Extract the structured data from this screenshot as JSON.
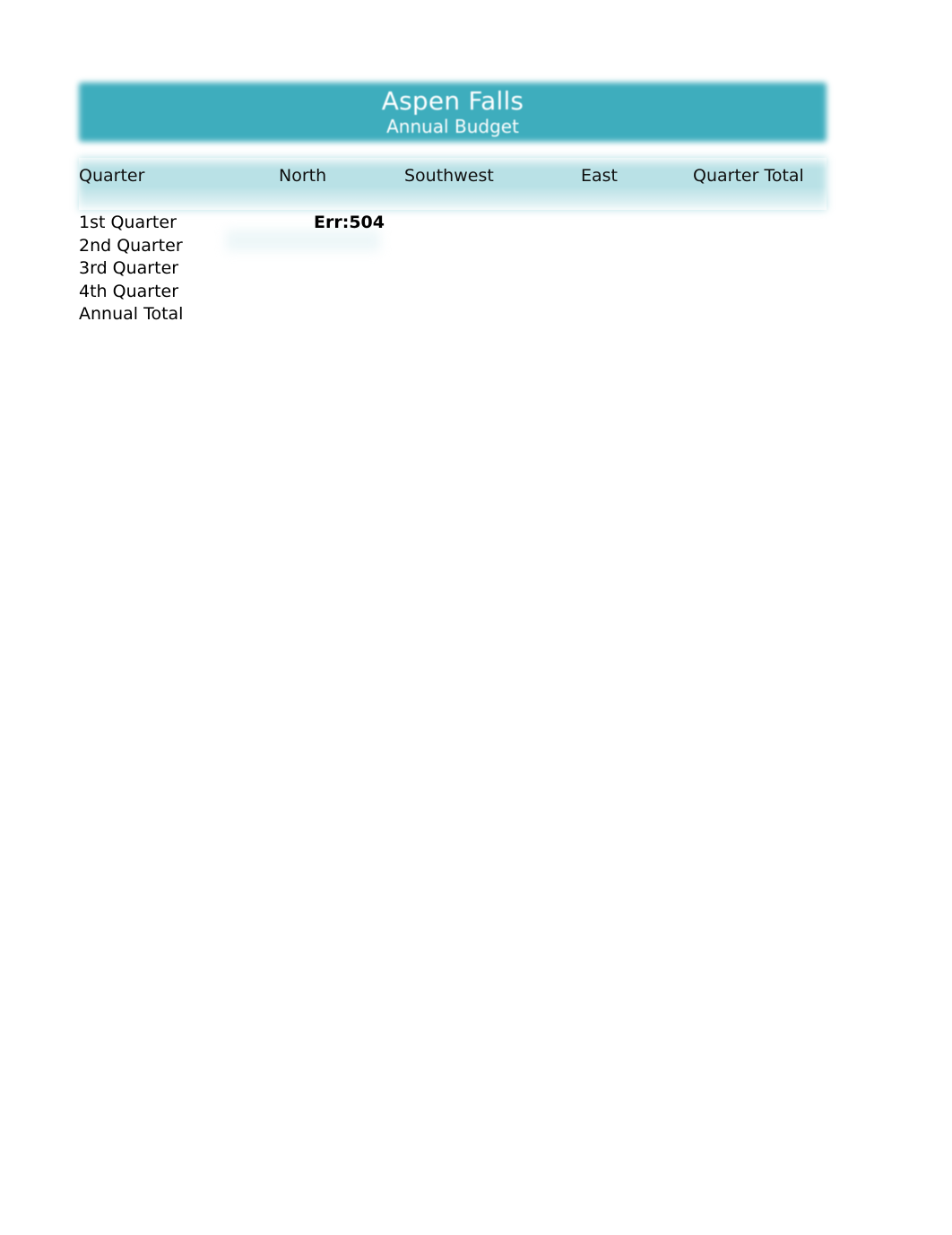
{
  "document": {
    "title": "Aspen Falls",
    "subtitle": "Annual Budget"
  },
  "colors": {
    "banner_teal": "#3EADBD",
    "header_band": "#B9E1E6",
    "page_background": "#FFFFFF",
    "text": "#000000",
    "banner_text": "#FFFFFF"
  },
  "table": {
    "columns": [
      {
        "key": "quarter",
        "label": "Quarter"
      },
      {
        "key": "north",
        "label": "North"
      },
      {
        "key": "southwest",
        "label": "Southwest"
      },
      {
        "key": "east",
        "label": "East"
      },
      {
        "key": "quarter_total",
        "label": "Quarter Total"
      }
    ],
    "rows": [
      {
        "quarter": "1st Quarter",
        "north": "Err:504",
        "southwest": "",
        "east": "",
        "quarter_total": ""
      },
      {
        "quarter": "2nd Quarter",
        "north": "",
        "southwest": "",
        "east": "",
        "quarter_total": ""
      },
      {
        "quarter": "3rd Quarter",
        "north": "",
        "southwest": "",
        "east": "",
        "quarter_total": ""
      },
      {
        "quarter": "4th Quarter",
        "north": "",
        "southwest": "",
        "east": "",
        "quarter_total": ""
      },
      {
        "quarter": "Annual Total",
        "north": "",
        "southwest": "",
        "east": "",
        "quarter_total": ""
      }
    ]
  }
}
